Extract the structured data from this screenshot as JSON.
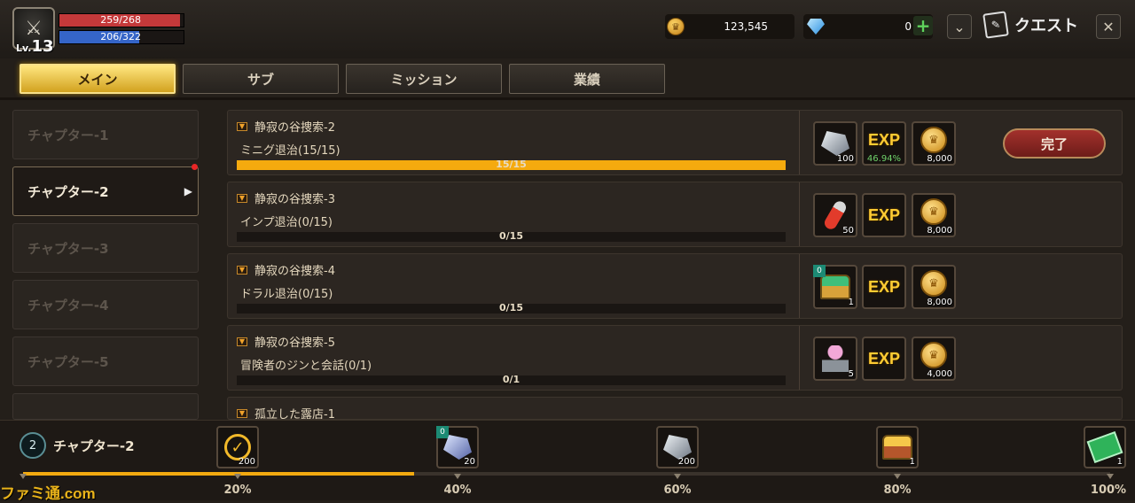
{
  "player": {
    "level_prefix": "Lv.",
    "level": "13",
    "hp": "259/268",
    "mp": "206/322"
  },
  "currency": {
    "gold": "123,545",
    "gems": "0"
  },
  "header": {
    "title": "クエスト"
  },
  "tabs": [
    {
      "label": "メイン",
      "active": true
    },
    {
      "label": "サブ"
    },
    {
      "label": "ミッション"
    },
    {
      "label": "業績"
    }
  ],
  "chapters": [
    {
      "label": "チャプター-1"
    },
    {
      "label": "チャプター-2",
      "active": true
    },
    {
      "label": "チャプター-3"
    },
    {
      "label": "チャプター-4"
    },
    {
      "label": "チャプター-5"
    }
  ],
  "quests": [
    {
      "name": "静寂の谷捜索-2",
      "goal": "ミニグ退治(15/15)",
      "progress_text": "15/15",
      "progress": 1.0,
      "rewards": [
        {
          "icon": "ore-icon",
          "count": "100"
        },
        {
          "icon": "exp-icon",
          "label": "EXP",
          "pct": "46.94%"
        },
        {
          "icon": "gold-coin-icon",
          "count": "8,000"
        }
      ],
      "button": "完了"
    },
    {
      "name": "静寂の谷捜索-3",
      "goal": "インプ退治(0/15)",
      "progress_text": "0/15",
      "progress": 0.0,
      "rewards": [
        {
          "icon": "potion-icon",
          "count": "50"
        },
        {
          "icon": "exp-icon",
          "label": "EXP"
        },
        {
          "icon": "gold-coin-icon",
          "count": "8,000"
        }
      ]
    },
    {
      "name": "静寂の谷捜索-4",
      "goal": "ドラル退治(0/15)",
      "progress_text": "0/15",
      "progress": 0.0,
      "rewards": [
        {
          "icon": "chest-icon",
          "count": "1",
          "badge": "0"
        },
        {
          "icon": "exp-icon",
          "label": "EXP"
        },
        {
          "icon": "gold-coin-icon",
          "count": "8,000"
        }
      ]
    },
    {
      "name": "静寂の谷捜索-5",
      "goal": "冒険者のジンと会話(0/1)",
      "progress_text": "0/1",
      "progress": 0.0,
      "rewards": [
        {
          "icon": "anvil-icon",
          "count": "5"
        },
        {
          "icon": "exp-icon",
          "label": "EXP"
        },
        {
          "icon": "gold-coin-icon",
          "count": "4,000"
        }
      ]
    },
    {
      "name": "孤立した露店-1"
    }
  ],
  "chapter_progress": {
    "number": "2",
    "label": "チャプター-2",
    "progress": 0.36,
    "milestones": [
      {
        "pct": "20%",
        "icon": "check-medal-icon",
        "count": "200"
      },
      {
        "pct": "40%",
        "icon": "crystal-ore-icon",
        "count": "20",
        "badge": "0"
      },
      {
        "pct": "60%",
        "icon": "ore-icon",
        "count": "200"
      },
      {
        "pct": "80%",
        "icon": "gold-chest-icon",
        "count": "1"
      },
      {
        "pct": "100%",
        "icon": "ticket-icon",
        "count": "1"
      }
    ]
  },
  "watermark": "ファミ通.com",
  "colors": {
    "accent": "#f5aa0e",
    "hp": "#c4393a",
    "mp": "#3565c8",
    "done_button": "#a3312c"
  }
}
